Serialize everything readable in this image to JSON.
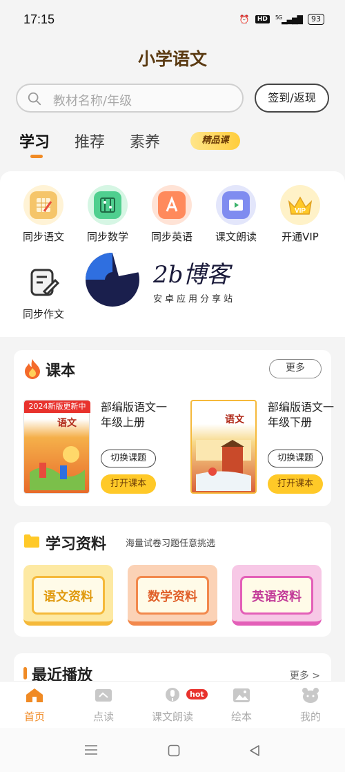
{
  "status_bar": {
    "time": "17:15",
    "hd": "HD",
    "network": "5G",
    "battery": "93"
  },
  "app": {
    "title": "小学语文"
  },
  "search": {
    "placeholder": "教材名称/年级"
  },
  "checkin_button": "签到/返现",
  "tabs": [
    {
      "label": "学习",
      "active": true
    },
    {
      "label": "推荐",
      "active": false
    },
    {
      "label": "素养",
      "active": false
    }
  ],
  "premium_badge": "精品课",
  "grid": [
    {
      "label": "同步语文",
      "icon": "chinese-book-icon",
      "color": "#f5c56a"
    },
    {
      "label": "同步数学",
      "icon": "abacus-icon",
      "color": "#4fcf8f"
    },
    {
      "label": "同步英语",
      "icon": "english-a-icon",
      "color": "#ff8a5c"
    },
    {
      "label": "课文朗读",
      "icon": "play-book-icon",
      "color": "#7f8cf0"
    },
    {
      "label": "开通VIP",
      "icon": "vip-crown-icon",
      "color": "#ffc928"
    },
    {
      "label": "同步作文",
      "icon": "writing-pen-icon",
      "color": "#444444"
    }
  ],
  "watermark": {
    "title": "2b博客",
    "subtitle": "安卓应用分享站"
  },
  "textbooks": {
    "title": "课本",
    "more": "更多",
    "books": [
      {
        "title": "部编版语文一年级上册",
        "ribbon": "2024新版更新中",
        "cover_label": "语文",
        "switch": "切换课题",
        "open": "打开课本"
      },
      {
        "title": "部编版语文一年级下册",
        "ribbon": "",
        "cover_label": "语文",
        "switch": "切换课题",
        "open": "打开课本"
      }
    ]
  },
  "materials": {
    "title": "学习资料",
    "subtitle": "海量试卷习题任意挑选",
    "tiles": [
      {
        "label": "语文资料",
        "color": "#f5b93a"
      },
      {
        "label": "数学资料",
        "color": "#f2884c"
      },
      {
        "label": "英语资料",
        "color": "#e35fb8"
      }
    ]
  },
  "recent": {
    "title": "最近播放",
    "more": "更多 >"
  },
  "bottom_nav": [
    {
      "label": "首页",
      "icon": "home-icon",
      "active": true
    },
    {
      "label": "点读",
      "icon": "point-read-icon",
      "active": false
    },
    {
      "label": "课文朗读",
      "icon": "microphone-icon",
      "active": false
    },
    {
      "label": "绘本",
      "icon": "picture-book-icon",
      "active": false
    },
    {
      "label": "我的",
      "icon": "profile-icon",
      "active": false
    }
  ],
  "hot_badge": "hot",
  "colors": {
    "accent": "#f08a24",
    "button_yellow": "#ffc928"
  }
}
